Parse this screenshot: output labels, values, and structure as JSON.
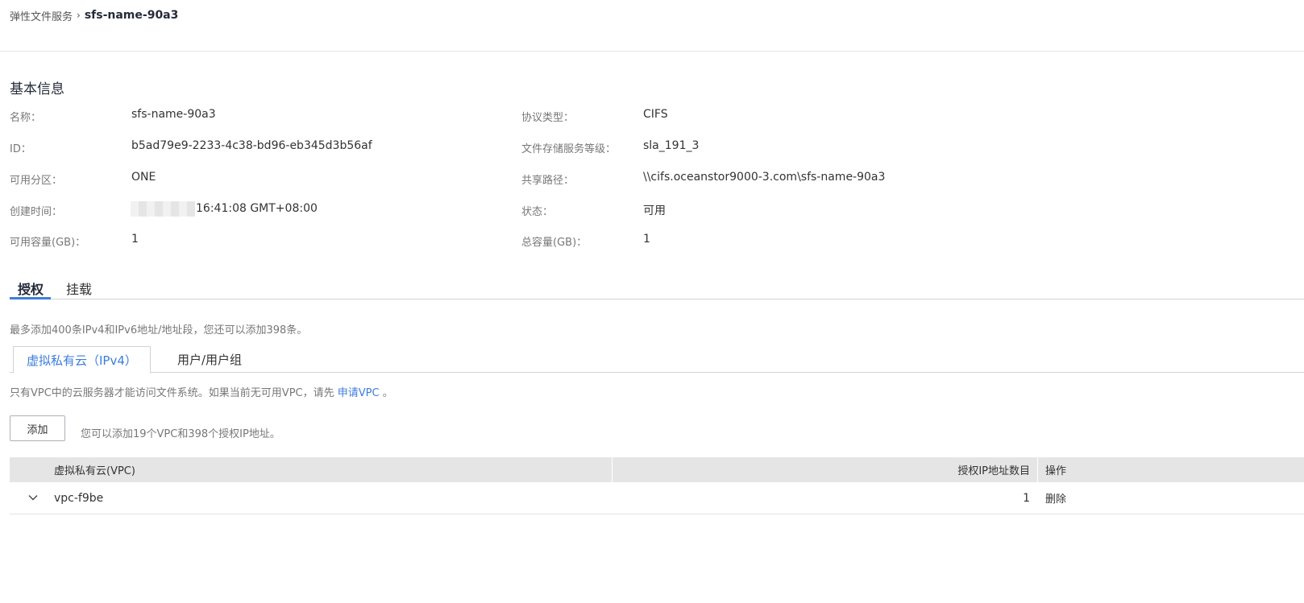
{
  "breadcrumb": {
    "parent": "弹性文件服务",
    "separator": "›",
    "current": "sfs-name-90a3"
  },
  "basic_info": {
    "title": "基本信息",
    "left": [
      {
        "label": "名称：",
        "value": "sfs-name-90a3"
      },
      {
        "label": "ID：",
        "value": "b5ad79e9-2233-4c38-bd96-eb345d3b56af"
      },
      {
        "label": "可用分区：",
        "value": "ONE"
      },
      {
        "label": "创建时间：",
        "value": "16:41:08 GMT+08:00"
      },
      {
        "label": "可用容量(GB)：",
        "value": "1"
      }
    ],
    "right": [
      {
        "label": "协议类型：",
        "value": "CIFS"
      },
      {
        "label": "文件存储服务等级：",
        "value": "sla_191_3"
      },
      {
        "label": "共享路径：",
        "value": "\\\\cifs.oceanstor9000-3.com\\sfs-name-90a3"
      },
      {
        "label": "状态：",
        "value": "可用"
      },
      {
        "label": "总容量(GB)：",
        "value": "1"
      }
    ]
  },
  "tabs": {
    "items": [
      {
        "label": "授权",
        "active": true
      },
      {
        "label": "挂载",
        "active": false
      }
    ]
  },
  "auth": {
    "limit_hint": "最多添加400条IPv4和IPv6地址/地址段，您还可以添加398条。",
    "subtabs": [
      {
        "label": "虚拟私有云（IPv4）",
        "active": true
      },
      {
        "label": "用户/用户组",
        "active": false
      }
    ],
    "vpc_hint_prefix": "只有VPC中的云服务器才能访问文件系统。如果当前无可用VPC，请先",
    "vpc_hint_link": "申请VPC",
    "vpc_hint_suffix": "。",
    "add_button": "添加",
    "add_hint": "您可以添加19个VPC和398个授权IP地址。",
    "table": {
      "columns": [
        "虚拟私有云(VPC)",
        "授权IP地址数目",
        "操作"
      ],
      "rows": [
        {
          "vpc": "vpc-f9be",
          "ip_count": "1",
          "action": "删除"
        }
      ]
    }
  },
  "colors": {
    "accent": "#3c7ddc",
    "header_bg": "#e5e5e5",
    "label": "#777777"
  }
}
